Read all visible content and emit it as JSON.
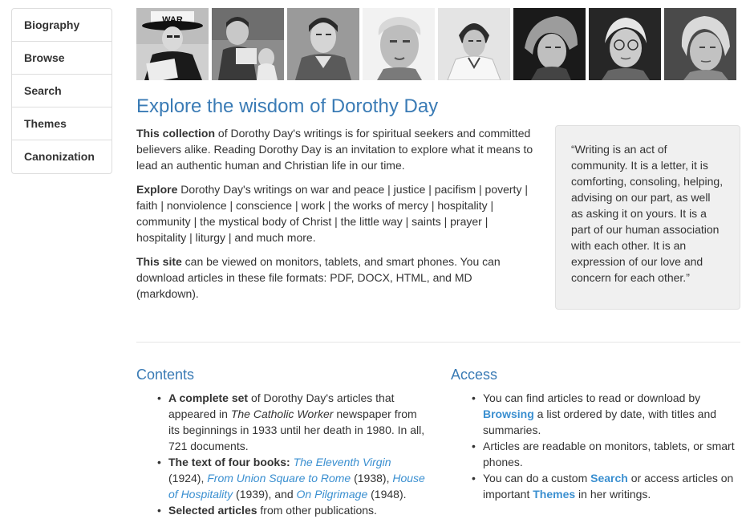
{
  "sidebar": {
    "items": [
      {
        "label": "Biography"
      },
      {
        "label": "Browse"
      },
      {
        "label": "Search"
      },
      {
        "label": "Themes"
      },
      {
        "label": "Canonization"
      }
    ]
  },
  "page_title": "Explore the wisdom of Dorothy Day",
  "intro": {
    "p1_bold": "This collection",
    "p1_rest": " of Dorothy Day's writings is for spiritual seekers and committed believers alike. Reading Dorothy Day is an invitation to explore what it means to lead an authentic human and Christian life in our time.",
    "p2_bold": "Explore",
    "p2_rest": " Dorothy Day's writings on war and peace | justice | pacifism | poverty | faith | nonviolence | conscience | work | the works of mercy | hospitality | community | the mystical body of Christ | the little way | saints | prayer | hospitality | liturgy | and much more.",
    "p3_bold": "This site",
    "p3_rest": " can be viewed on monitors, tablets, and smart phones. You can download articles in these file formats: PDF, DOCX, HTML, and MD (markdown)."
  },
  "quote": "“Writing is an act of community. It is a letter, it is comforting, consoling, helping, advising on our part, as well as asking it on yours. It is a part of our human association with each other. It is an expression of our love and concern for each other.”",
  "contents": {
    "heading": "Contents",
    "item1_bold": "A complete set",
    "item1_a": " of Dorothy Day's articles that appeared in ",
    "item1_italic": "The Catholic Worker",
    "item1_b": " newspaper from its beginnings in 1933 until her death in 1980. In all, 721 documents.",
    "item2_bold": "The text of four books:",
    "book1": "The Eleventh Virgin",
    "book1_year": " (1924),",
    "book2": "From Union Square to Rome",
    "book2_year": " (1938), ",
    "book3": "House of Hospitality",
    "book3_year": " (1939), and ",
    "book4": "On Pilgrimage",
    "book4_year": " (1948).",
    "item3_bold": "Selected articles",
    "item3_rest": " from other publications."
  },
  "access": {
    "heading": "Access",
    "item1_a": "You can find articles to read or download by ",
    "item1_link": "Browsing",
    "item1_b": " a list ordered by date, with titles and summaries.",
    "item2": "Articles are readable on monitors, tablets, or smart phones.",
    "item3_a": "You can do a custom ",
    "item3_link1": "Search",
    "item3_b": " or access articles on important ",
    "item3_link2": "Themes",
    "item3_c": " in her writings."
  },
  "photo_sign_text": "WAR"
}
